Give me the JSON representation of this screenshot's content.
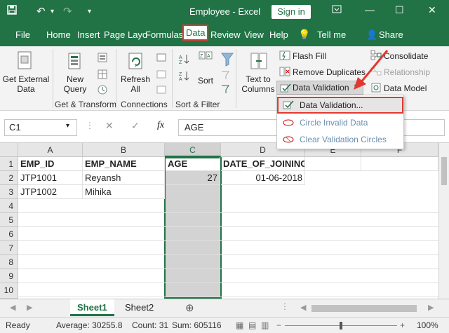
{
  "window": {
    "title": "Employee - Excel",
    "signin_label": "Sign in"
  },
  "tabs": [
    "File",
    "Home",
    "Insert",
    "Page Layo",
    "Formulas",
    "Data",
    "Review",
    "View",
    "Help",
    "Tell me",
    "Share"
  ],
  "ribbon": {
    "get_external_data": "Get External Data",
    "new_query": "New Query",
    "refresh_all": "Refresh All",
    "sort": "Sort",
    "text_to_columns": "Text to Columns",
    "flash_fill": "Flash Fill",
    "remove_duplicates": "Remove Duplicates",
    "data_validation": "Data Validation",
    "consolidate": "Consolidate",
    "relationships": "Relationship",
    "data_model": "Data Model",
    "groups": {
      "get_transform": "Get & Transform",
      "connections": "Connections",
      "sort_filter": "Sort & Filter"
    }
  },
  "dropdown": {
    "items": [
      "Data Validation...",
      "Circle Invalid Data",
      "Clear Validation Circles"
    ]
  },
  "formula_bar": {
    "name_box": "C1",
    "fx": "fx",
    "content": "AGE"
  },
  "grid": {
    "columns": [
      "A",
      "B",
      "C",
      "D",
      "E",
      "F"
    ],
    "rows": [
      "1",
      "2",
      "3",
      "4",
      "5",
      "6",
      "7",
      "8",
      "9",
      "10"
    ],
    "cells": [
      [
        "EMP_ID",
        "EMP_NAME",
        "AGE",
        "DATE_OF_JOINING",
        "",
        ""
      ],
      [
        "JTP1001",
        "Reyansh",
        "27",
        "01-06-2018",
        "",
        ""
      ],
      [
        "JTP1002",
        "Mihika",
        "",
        "",
        "",
        ""
      ]
    ]
  },
  "sheets": [
    "Sheet1",
    "Sheet2"
  ],
  "status": {
    "ready": "Ready",
    "average": "Average: 30255.8",
    "count": "Count: 31",
    "sum": "Sum: 605116",
    "zoom": "100%"
  },
  "colors": {
    "excel_green": "#217346",
    "highlight_red": "#e3382f"
  }
}
